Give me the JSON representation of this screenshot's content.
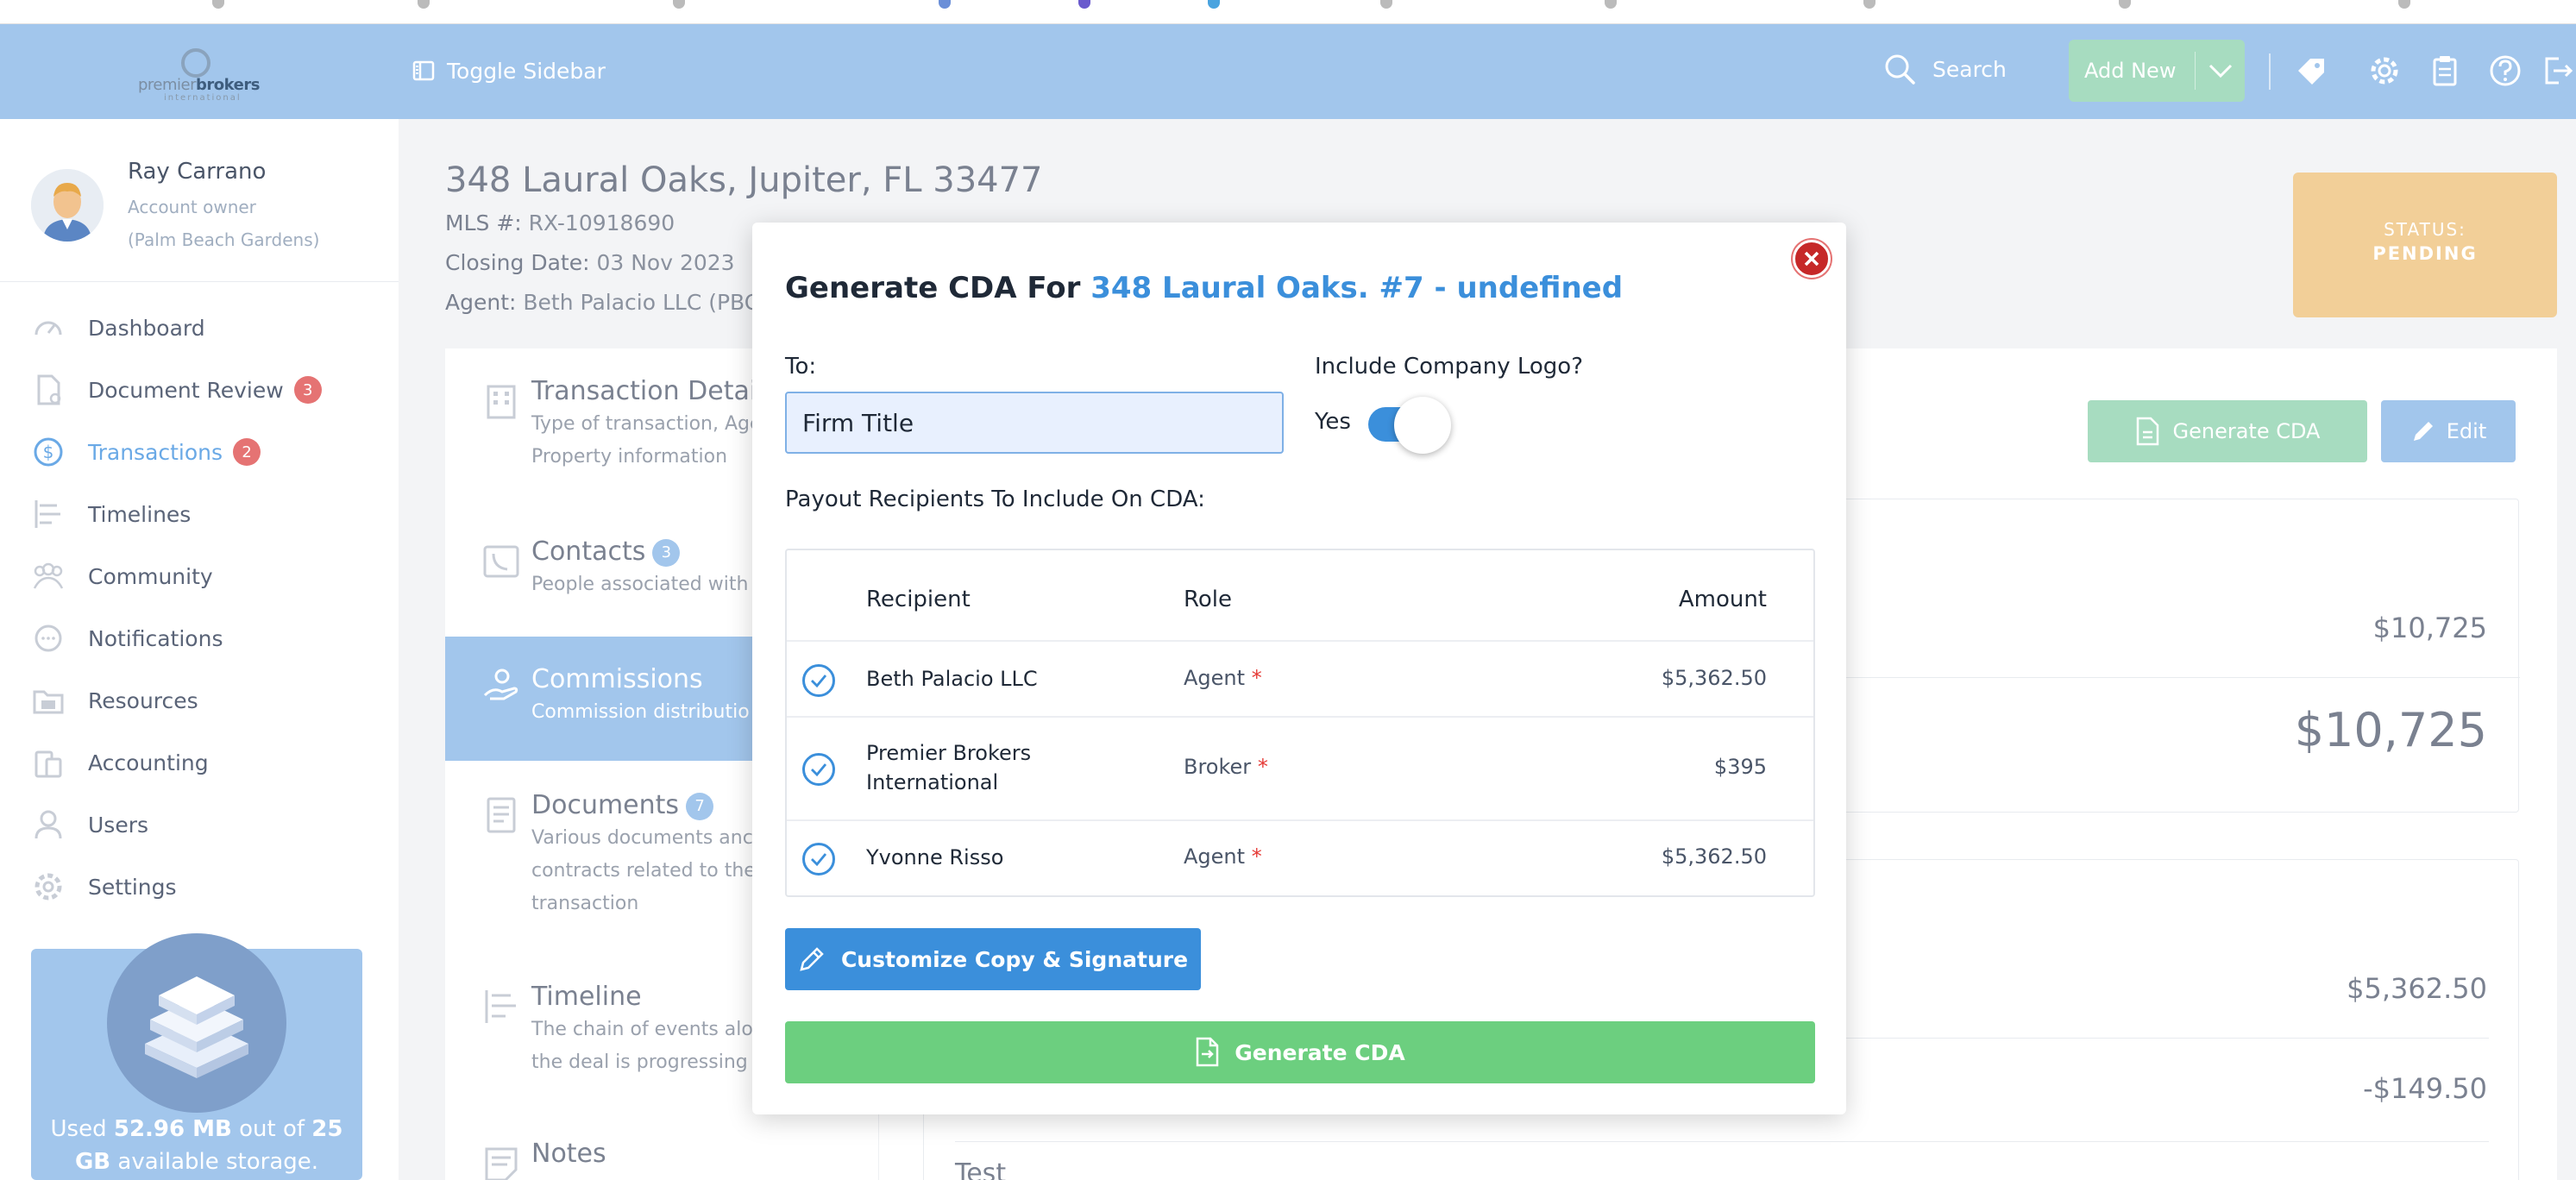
{
  "header": {
    "logo_text_a": "premier",
    "logo_text_b": "brokers",
    "logo_sub": "international",
    "toggle_sidebar": "Toggle Sidebar",
    "search": "Search",
    "add_new": "Add New"
  },
  "user": {
    "name": "Ray Carrano",
    "role": "Account owner",
    "office": "(Palm Beach Gardens)"
  },
  "sidebar": {
    "items": [
      {
        "label": "Dashboard",
        "icon": "dashboard-icon"
      },
      {
        "label": "Document Review",
        "icon": "document-icon",
        "badge": "3"
      },
      {
        "label": "Transactions",
        "icon": "dollar-icon",
        "badge": "2",
        "active": true
      },
      {
        "label": "Timelines",
        "icon": "timeline-icon"
      },
      {
        "label": "Community",
        "icon": "community-icon"
      },
      {
        "label": "Notifications",
        "icon": "chat-icon"
      },
      {
        "label": "Resources",
        "icon": "folder-icon"
      },
      {
        "label": "Accounting",
        "icon": "accounting-icon"
      },
      {
        "label": "Users",
        "icon": "user-icon"
      },
      {
        "label": "Settings",
        "icon": "gear-icon"
      }
    ],
    "storage": {
      "prefix": "Used ",
      "used": "52.96 MB",
      "middle": " out of ",
      "total": "25 GB",
      "suffix": " available storage."
    }
  },
  "property": {
    "title": "348 Laural Oaks, Jupiter, FL 33477",
    "mls_label": "MLS #:",
    "mls_value": "RX-10918690",
    "closing_label": "Closing Date:",
    "closing_value": "03 Nov 2023",
    "agent_label": "Agent:",
    "agent_value": "Beth Palacio LLC (PBG"
  },
  "status": {
    "label": "STATUS:",
    "value": "PENDING"
  },
  "subnav": [
    {
      "title": "Transaction Detai",
      "desc": [
        "Type of transaction, Age",
        "Property information"
      ]
    },
    {
      "title": "Contacts",
      "badge": "3",
      "desc": [
        "People associated with"
      ]
    },
    {
      "title": "Commissions",
      "desc": [
        "Commission distributio"
      ],
      "active": true
    },
    {
      "title": "Documents",
      "badge": "7",
      "desc": [
        "Various documents anc",
        "contracts related to the",
        "transaction"
      ]
    },
    {
      "title": "Timeline",
      "desc": [
        "The chain of events alor",
        "the deal is progressing"
      ]
    },
    {
      "title": "Notes",
      "desc": []
    }
  ],
  "actions": {
    "generate_cda": "Generate CDA",
    "edit": "Edit"
  },
  "amounts": {
    "a1": "$10,725",
    "a2": "$10,725",
    "a3": "$5,362.50",
    "a4": "-$149.50",
    "row_label": "Test"
  },
  "modal": {
    "title_prefix": "Generate CDA For ",
    "title_highlight": "348 Laural Oaks. #7 - undefined",
    "to_label": "To:",
    "to_value": "Firm Title",
    "logo_label": "Include Company Logo?",
    "logo_toggle_label": "Yes",
    "logo_toggle_on": true,
    "payout_label": "Payout Recipients To Include On CDA:",
    "table": {
      "headers": [
        "Recipient",
        "Role",
        "Amount"
      ],
      "rows": [
        {
          "recipient": "Beth Palacio LLC",
          "role": "Agent",
          "required": "*",
          "amount": "$5,362.50"
        },
        {
          "recipient": "Premier Brokers International",
          "recipient_l1": "Premier Brokers",
          "recipient_l2": "International",
          "role": "Broker",
          "required": "*",
          "amount": "$395"
        },
        {
          "recipient": "Yvonne Risso",
          "role": "Agent",
          "required": "*",
          "amount": "$5,362.50"
        }
      ]
    },
    "customize_button": "Customize Copy & Signature",
    "generate_button": "Generate CDA"
  }
}
